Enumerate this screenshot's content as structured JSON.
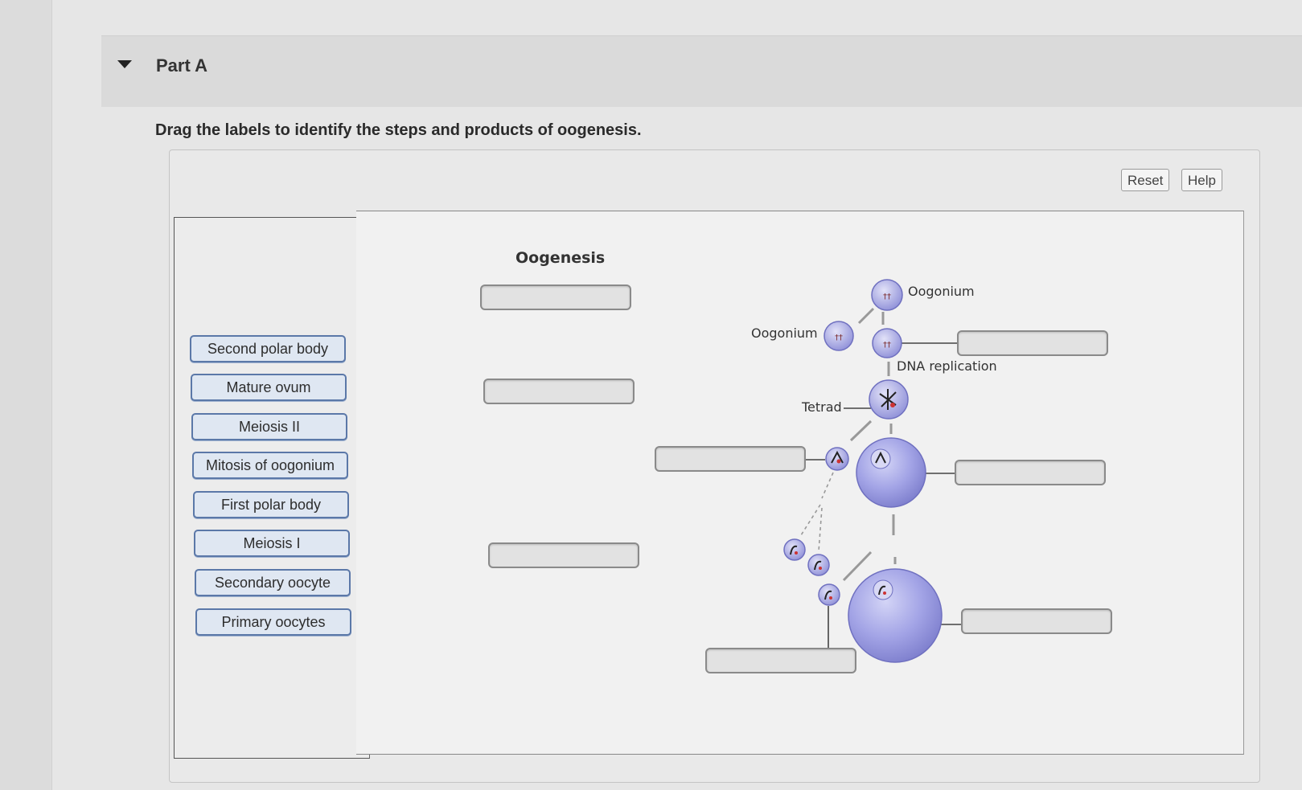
{
  "part": {
    "title": "Part A"
  },
  "instruction": "Drag the labels to identify the steps and products of oogenesis.",
  "toolbar": {
    "reset_label": "Reset",
    "help_label": "Help"
  },
  "labels": [
    "Second polar body",
    "Mature ovum",
    "Meiosis II",
    "Mitosis of oogonium",
    "First polar body",
    "Meiosis I",
    "Secondary oocyte",
    "Primary oocytes"
  ],
  "diagram": {
    "title": "Oogenesis",
    "oogonium_top": "Oogonium",
    "oogonium_left": "Oogonium",
    "dna_replication": "DNA replication",
    "tetrad": "Tetrad"
  },
  "colors": {
    "chip_border": "#5b78a8",
    "chip_fill": "#dfe7f2",
    "cell_fill": "#9d9ee0",
    "cell_edge": "#6f70c0"
  }
}
